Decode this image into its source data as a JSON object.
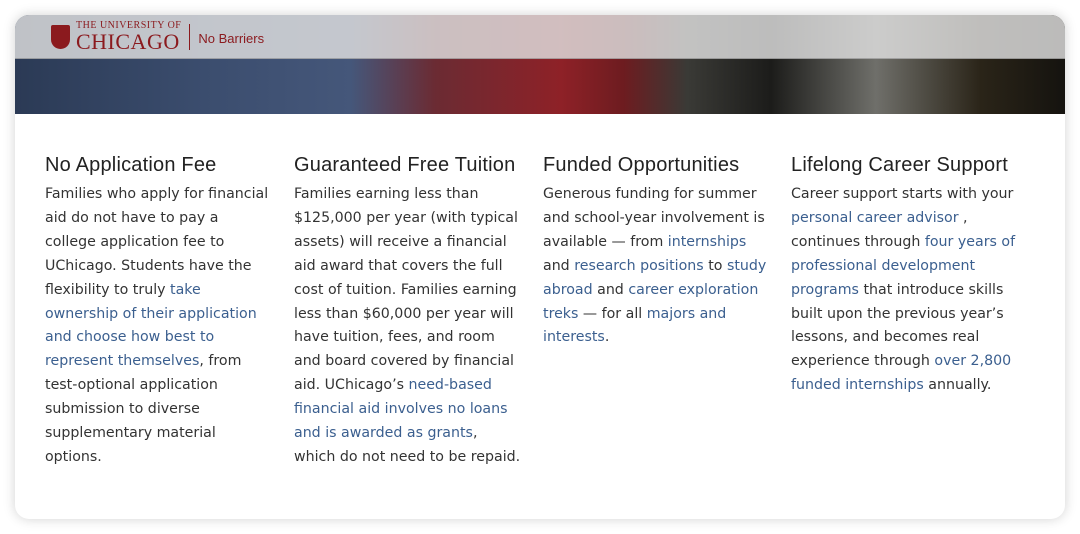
{
  "header": {
    "logo_top": "THE UNIVERSITY OF",
    "logo_main": "CHICAGO",
    "tagline": "No Barriers",
    "brand_color": "#8b1a1e",
    "link_color": "#3b5f8f"
  },
  "columns": [
    {
      "title": "No Application Fee",
      "body": [
        {
          "text": "Families who apply for financial aid do not have to pay a college application fee to UChicago. Students have the flexibility to truly "
        },
        {
          "text": "take ownership of their application and choose how best to represent themselves",
          "link": true
        },
        {
          "text": ", from test-optional application submission to diverse supplementary material options."
        }
      ]
    },
    {
      "title": "Guaranteed Free Tuition",
      "body": [
        {
          "text": "Families earning less than $125,000 per year (with typical assets) will receive a financial aid award that covers the full cost of tuition. Families earning less than $60,000 per year will have tuition, fees, and room and board covered by financial aid. UChicago’s "
        },
        {
          "text": "need-based financial aid involves no loans and is awarded as grants",
          "link": true
        },
        {
          "text": ", which do not need to be repaid."
        }
      ]
    },
    {
      "title": "Funded Opportunities",
      "body": [
        {
          "text": "Generous funding for summer and school-year involvement is available — from "
        },
        {
          "text": "internships",
          "link": true
        },
        {
          "text": " and "
        },
        {
          "text": "research positions",
          "link": true
        },
        {
          "text": " to "
        },
        {
          "text": "study abroad",
          "link": true
        },
        {
          "text": " and "
        },
        {
          "text": "career exploration treks",
          "link": true
        },
        {
          "text": " — for all "
        },
        {
          "text": "majors and interests",
          "link": true
        },
        {
          "text": "."
        }
      ]
    },
    {
      "title": "Lifelong Career Support",
      "body": [
        {
          "text": "Career support starts with your "
        },
        {
          "text": "personal career advisor",
          "link": true
        },
        {
          "text": " , continues through "
        },
        {
          "text": "four years of professional development programs",
          "link": true
        },
        {
          "text": " that introduce skills built upon the previous year’s lessons, and becomes real experience through "
        },
        {
          "text": "over 2,800 funded internships",
          "link": true
        },
        {
          "text": " annually."
        }
      ]
    }
  ]
}
